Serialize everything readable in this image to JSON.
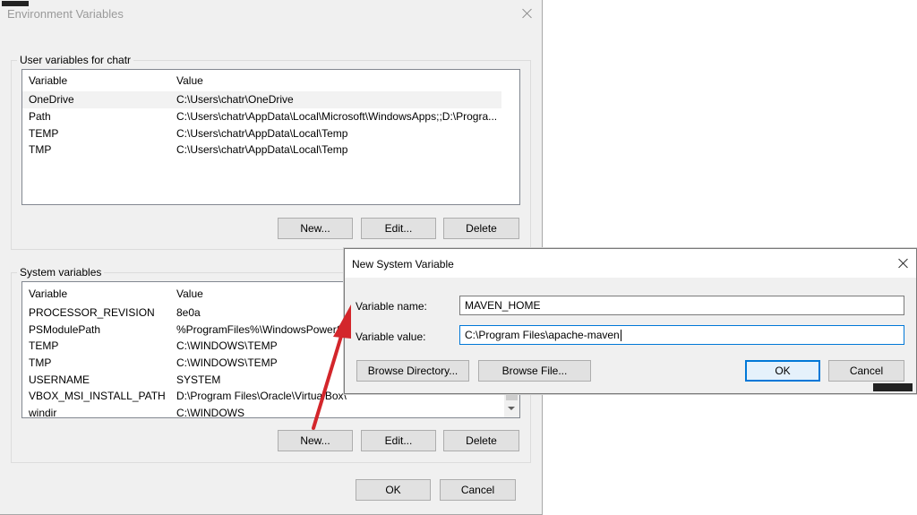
{
  "main_window": {
    "title": "Environment Variables",
    "user_group": {
      "label": "User variables for chatr",
      "columns": [
        "Variable",
        "Value"
      ],
      "rows": [
        {
          "variable": "OneDrive",
          "value": "C:\\Users\\chatr\\OneDrive"
        },
        {
          "variable": "Path",
          "value": "C:\\Users\\chatr\\AppData\\Local\\Microsoft\\WindowsApps;;D:\\Progra..."
        },
        {
          "variable": "TEMP",
          "value": "C:\\Users\\chatr\\AppData\\Local\\Temp"
        },
        {
          "variable": "TMP",
          "value": "C:\\Users\\chatr\\AppData\\Local\\Temp"
        }
      ],
      "buttons": {
        "new": "New...",
        "edit": "Edit...",
        "delete": "Delete"
      }
    },
    "system_group": {
      "label": "System variables",
      "columns": [
        "Variable",
        "Value"
      ],
      "rows": [
        {
          "variable": "PROCESSOR_REVISION",
          "value": "8e0a"
        },
        {
          "variable": "PSModulePath",
          "value": "%ProgramFiles%\\WindowsPowerSh"
        },
        {
          "variable": "TEMP",
          "value": "C:\\WINDOWS\\TEMP"
        },
        {
          "variable": "TMP",
          "value": "C:\\WINDOWS\\TEMP"
        },
        {
          "variable": "USERNAME",
          "value": "SYSTEM"
        },
        {
          "variable": "VBOX_MSI_INSTALL_PATH",
          "value": "D:\\Program Files\\Oracle\\VirtualBox\\"
        },
        {
          "variable": "windir",
          "value": "C:\\WINDOWS"
        }
      ],
      "buttons": {
        "new": "New...",
        "edit": "Edit...",
        "delete": "Delete"
      }
    },
    "footer": {
      "ok": "OK",
      "cancel": "Cancel"
    }
  },
  "dialog": {
    "title": "New System Variable",
    "name_label": "Variable name:",
    "name_value": "MAVEN_HOME",
    "value_label": "Variable value:",
    "value_value": "C:\\Program Files\\apache-maven",
    "buttons": {
      "browse_dir": "Browse Directory...",
      "browse_file": "Browse File...",
      "ok": "OK",
      "cancel": "Cancel"
    }
  },
  "colors": {
    "annotation_arrow": "#d3262b",
    "focus_border": "#0078d7"
  },
  "icons": {
    "window_close": "close-icon",
    "annotation": "red-arrow"
  }
}
